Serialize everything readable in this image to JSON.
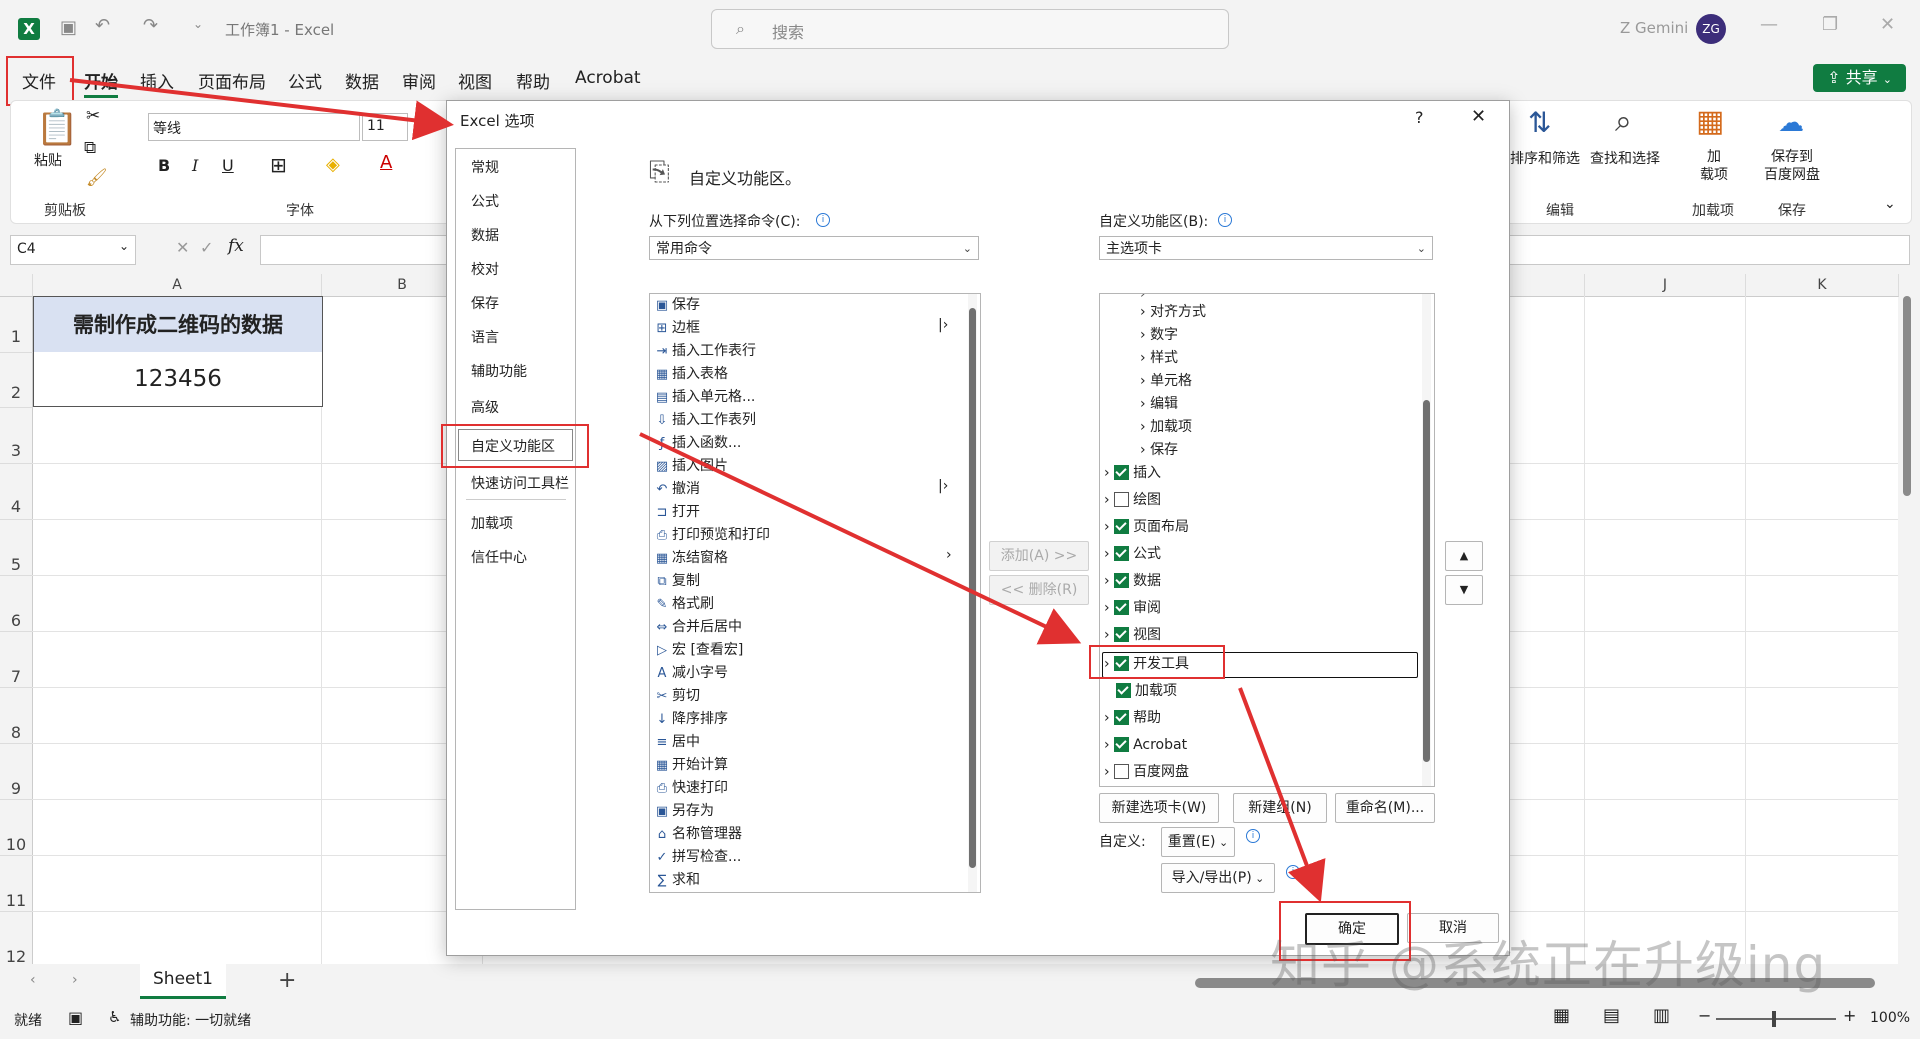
{
  "window": {
    "doc_title": "工作簿1  -  Excel",
    "search_placeholder": "搜索",
    "user_name": "Z Gemini",
    "avatar_initials": "ZG"
  },
  "menu": {
    "file": "文件",
    "tabs": [
      "开始",
      "插入",
      "页面布局",
      "公式",
      "数据",
      "审阅",
      "视图",
      "帮助",
      "Acrobat"
    ],
    "share": "共享"
  },
  "ribbon": {
    "paste": "粘贴",
    "clipboard_label": "剪贴板",
    "font_name": "等线",
    "font_size": "11",
    "font_label": "字体",
    "bold": "B",
    "italic": "I",
    "underline": "U",
    "sort_filter": "排序和筛选",
    "find_select": "查找和选择",
    "edit_label": "编辑",
    "addins_button": "加\n载项",
    "addins_label": "加载项",
    "save_baidu": "保存到\n百度网盘",
    "save_label": "保存"
  },
  "formula_bar": {
    "name_box": "C4",
    "fx": "fx"
  },
  "sheet": {
    "columns": [
      "A",
      "B",
      "J",
      "K"
    ],
    "rows": [
      "1",
      "2",
      "3",
      "4",
      "5",
      "6",
      "7",
      "8",
      "9",
      "10",
      "11",
      "12"
    ],
    "cell_a1": "需制作成二维码的数据",
    "cell_a2": "123456",
    "tab_name": "Sheet1"
  },
  "status": {
    "ready": "就绪",
    "accessibility": "辅助功能: 一切就绪",
    "zoom": "100%"
  },
  "dialog": {
    "title": "Excel 选项",
    "help": "?",
    "nav": [
      "常规",
      "公式",
      "数据",
      "校对",
      "保存",
      "语言",
      "辅助功能",
      "高级",
      "自定义功能区",
      "快速访问工具栏",
      "加载项",
      "信任中心"
    ],
    "heading": "自定义功能区。",
    "choose_from_label": "从下列位置选择命令(C):",
    "choose_from_value": "常用命令",
    "customize_label": "自定义功能区(B):",
    "customize_value": "主选项卡",
    "commands": [
      "保存",
      "边框",
      "插入工作表行",
      "插入表格",
      "插入单元格...",
      "插入工作表列",
      "插入函数...",
      "插入图片",
      "撤消",
      "打开",
      "打印预览和打印",
      "冻结窗格",
      "复制",
      "格式刷",
      "合并后居中",
      "宏 [查看宏]",
      "减小字号",
      "剪切",
      "降序排序",
      "居中",
      "开始计算",
      "快速打印",
      "另存为",
      "名称管理器",
      "拼写检查...",
      "求和"
    ],
    "sub_groups": [
      "对齐方式",
      "数字",
      "样式",
      "单元格",
      "编辑",
      "加载项",
      "保存"
    ],
    "tabs": [
      {
        "label": "插入",
        "checked": true
      },
      {
        "label": "绘图",
        "checked": false
      },
      {
        "label": "页面布局",
        "checked": true
      },
      {
        "label": "公式",
        "checked": true
      },
      {
        "label": "数据",
        "checked": true
      },
      {
        "label": "审阅",
        "checked": true
      },
      {
        "label": "视图",
        "checked": true
      },
      {
        "label": "开发工具",
        "checked": true
      },
      {
        "label": "加载项",
        "checked": true
      },
      {
        "label": "帮助",
        "checked": true
      },
      {
        "label": "Acrobat",
        "checked": true
      },
      {
        "label": "百度网盘",
        "checked": false
      }
    ],
    "add_button": "添加(A) >>",
    "remove_button": "<< 删除(R)",
    "new_tab": "新建选项卡(W)",
    "new_group": "新建组(N)",
    "rename": "重命名(M)...",
    "customize_label2": "自定义:",
    "reset": "重置(E)",
    "import_export": "导入/导出(P)",
    "ok": "确定",
    "cancel": "取消"
  },
  "watermark": "知乎 @系统正在升级ing",
  "colors": {
    "excel_green": "#107c41",
    "annotation_red": "#e03030",
    "header_fill": "#d9e1f2"
  }
}
